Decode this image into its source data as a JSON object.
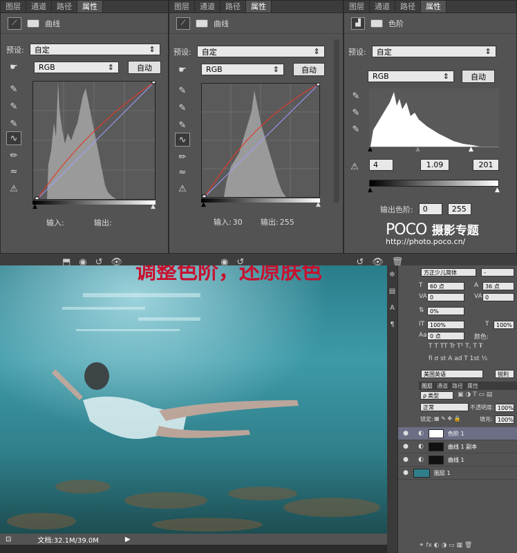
{
  "tabs": [
    "图层",
    "通道",
    "路径",
    "属性"
  ],
  "panels": [
    {
      "title": "曲线",
      "preset_label": "预设:",
      "preset_value": "自定",
      "channel": "RGB",
      "auto_label": "自动",
      "input_label": "输入:",
      "input_value": "",
      "output_label": "输出:",
      "output_value": ""
    },
    {
      "title": "曲线",
      "preset_label": "预设:",
      "preset_value": "自定",
      "channel": "RGB",
      "auto_label": "自动",
      "input_label": "输入:",
      "input_value": "30",
      "output_label": "输出:",
      "output_value": "255"
    },
    {
      "title": "色阶",
      "preset_label": "预设:",
      "preset_value": "自定",
      "channel": "RGB",
      "auto_label": "自动",
      "levels_black": "4",
      "levels_gamma": "1.09",
      "levels_white": "201",
      "output_label": "输出色阶:",
      "output_min": "0",
      "output_max": "255"
    }
  ],
  "headline": "调整色阶，还原肤色",
  "watermark": {
    "brand": "POCO",
    "subtitle": "摄影专题",
    "url": "http://photo.poco.cn/"
  },
  "status": {
    "doc": "文档:32.1M/39.0M"
  },
  "character": {
    "font": "方正少儿简体",
    "size": "60 点",
    "leading": "36 点",
    "tracking": "0",
    "kerning": "0",
    "baseline_shift": "0%",
    "vscale": "100%",
    "hscale": "100%",
    "shift": "0 点",
    "color_label": "颜色:",
    "language": "美国英语",
    "aa": "锐利"
  },
  "layers": {
    "tabs": [
      "图层",
      "通道",
      "路径",
      "属性"
    ],
    "kind": "类型",
    "blend": "正常",
    "opacity_label": "不透明度:",
    "opacity": "100%",
    "lock_label": "锁定:",
    "fill_label": "填充:",
    "fill": "100%",
    "items": [
      {
        "name": "色阶 1"
      },
      {
        "name": "曲线 1 副本"
      },
      {
        "name": "曲线 1"
      },
      {
        "name": "图层 1"
      }
    ]
  },
  "colors": {
    "red_text": "#c8102e",
    "curve_red": "#e03a2a",
    "curve_blue": "#9aa0ff"
  }
}
